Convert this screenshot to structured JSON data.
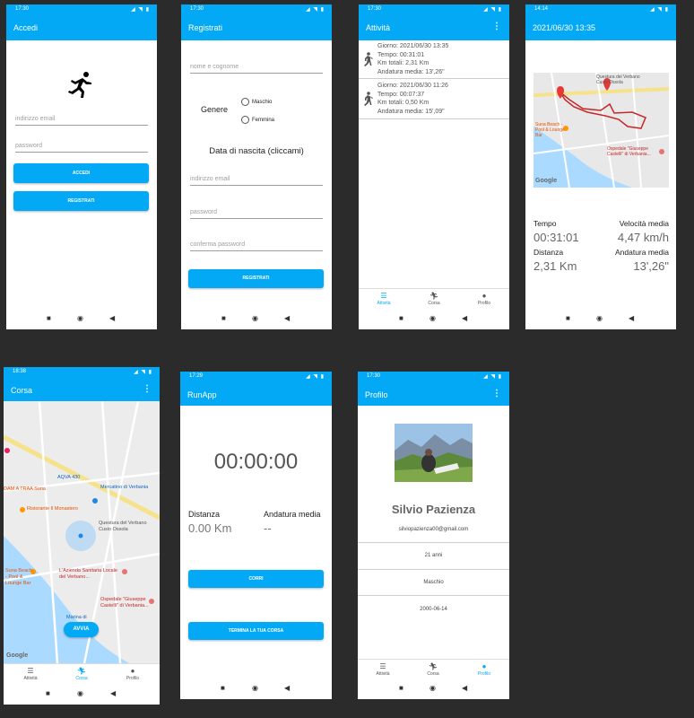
{
  "colors": {
    "accent": "#03a9f4",
    "route": "#c62828",
    "map_bg": "#e8e8e8",
    "lake": "#aadaff"
  },
  "status_icons": "◢ ◥ ▮",
  "nav_icons": {
    "square": "■",
    "circle": "◉",
    "back": "◀"
  },
  "login": {
    "time": "17:30",
    "title": "Accedi",
    "logo_icon": "runner-icon",
    "email_placeholder": "indirizzo email",
    "password_placeholder": "password",
    "login_button": "ACCEDI",
    "register_button": "REGISTRATI"
  },
  "register": {
    "time": "17:30",
    "title": "Registrati",
    "name_placeholder": "nome e cognome",
    "gender_label": "Genere",
    "gender_male": "Maschio",
    "gender_female": "Femmina",
    "birthdate": "Data di nascita (cliccami)",
    "email_placeholder": "indirizzo email",
    "password_placeholder": "password",
    "confirm_placeholder": "conferma password",
    "register_button": "REGISTRATI"
  },
  "activities": {
    "time": "17:30",
    "title": "Attività",
    "items": [
      {
        "line1": "Giorno: 2021/06/30 13:35",
        "line2": "Tempo: 00:31:01",
        "line3": "Km totali: 2,31 Km",
        "line4": "Andatura media: 13',26\""
      },
      {
        "line1": "Giorno: 2021/06/30 11:26",
        "line2": "Tempo: 00:07:37",
        "line3": "Km totali: 0,50 Km",
        "line4": "Andatura media: 15',09\""
      }
    ]
  },
  "bottom_nav": {
    "attivita": "Attività",
    "corsa": "Corsa",
    "profilo": "Profilo"
  },
  "detail": {
    "time": "14:14",
    "title": "2021/06/30 13:35",
    "map_labels": {
      "questura": "Questura del Verbano Cusio Ossola",
      "suna": "Suna Beach - Pool & Lounge Bar",
      "ospedale": "Ospedale \"Giuseppe Castelli\" di Verbania...",
      "google": "Google"
    },
    "tempo_label": "Tempo",
    "tempo_value": "00:31:01",
    "velocita_label": "Velocità media",
    "velocita_value": "4,47 km/h",
    "distanza_label": "Distanza",
    "distanza_value": "2,31 Km",
    "andatura_label": "Andatura media",
    "andatura_value": "13',26\""
  },
  "corsa": {
    "time": "18:38",
    "title": "Corsa",
    "map_labels": {
      "aqva": "AQVA 430",
      "mercatino": "Mercatino di Verbania",
      "dam": "DAM A TRAA Suna",
      "ristorante": "Ristorante Il Monastero",
      "questura": "Questura del Verbano Cusio Ossola",
      "suna": "Suna Beach - Pool & Lounge Bar",
      "azienda": "L'Azienda Sanitaria Locale del Verbano...",
      "ospedale": "Ospedale \"Giuseppe Castelli\" di Verbania...",
      "marina": "Marina di",
      "google": "Google"
    },
    "start_button": "AVVIA"
  },
  "runapp": {
    "time": "17:29",
    "title": "RunApp",
    "timer": "00:00:00",
    "distanza_label": "Distanza",
    "distanza_value": "0.00 Km",
    "andatura_label": "Andatura media",
    "andatura_value": "--",
    "corri_button": "CORRI",
    "termina_button": "TERMINA LA TUA CORSA"
  },
  "profile": {
    "time": "17:30",
    "title": "Profilo",
    "name": "Silvio Pazienza",
    "email": "silviopazienza00@gmail.com",
    "age": "21 anni",
    "gender": "Maschio",
    "birthdate": "2000-06-14"
  }
}
